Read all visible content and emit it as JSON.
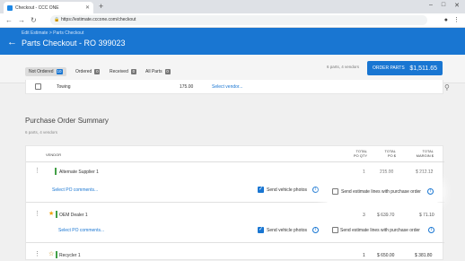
{
  "browser": {
    "tab_title": "Checkout - CCC ONE",
    "url": "https://estimate.cccone.com/checkout"
  },
  "header": {
    "breadcrumb": "Edit Estimate > Parts Checkout",
    "title": "Parts Checkout - RO 399023"
  },
  "tabs": [
    {
      "label": "Not Ordered",
      "count": "10"
    },
    {
      "label": "Ordered",
      "count": "0"
    },
    {
      "label": "Received",
      "count": "0"
    },
    {
      "label": "All Parts",
      "count": "0"
    }
  ],
  "order_summary_text": "6 parts, 4 vendors",
  "order_button": {
    "label": "ORDER PARTS",
    "amount": "$1,511.65"
  },
  "towing_row": {
    "name": "Towing",
    "price": "175.00",
    "vendor_link": "Select vendor..."
  },
  "po_summary": {
    "title": "Purchase Order Summary",
    "subtitle": "6 parts, 4 vendors",
    "columns": {
      "vendor": "VENDOR",
      "total_po_qty": [
        "TOTAL",
        "PO QTY"
      ],
      "total_po": [
        "TOTAL",
        "PO $"
      ],
      "total_margin": [
        "TOTAL",
        "MARGIN $"
      ]
    },
    "vendors": [
      {
        "name": "Alternate Supplier 1",
        "qty": "1",
        "po": "215.00",
        "margin": "$ 212.12",
        "comments": "Select PO comments...",
        "photos_label": "Send vehicle photos",
        "estimate_label": "Send estimate lines with purchase order"
      },
      {
        "name": "OEM Dealer 1",
        "qty": "3",
        "po": "$ 639.70",
        "margin": "$ 71.10",
        "comments": "Select PO comments...",
        "photos_label": "Send vehicle photos",
        "estimate_label": "Send estimate lines with purchase order"
      },
      {
        "name": "Recycler 1",
        "qty": "1",
        "po": "$ 650.00",
        "margin": "$ 381.80"
      }
    ]
  },
  "colors": {
    "primary": "#1976d2",
    "vendor_bar": "#43a047",
    "star": "#f0a000"
  }
}
